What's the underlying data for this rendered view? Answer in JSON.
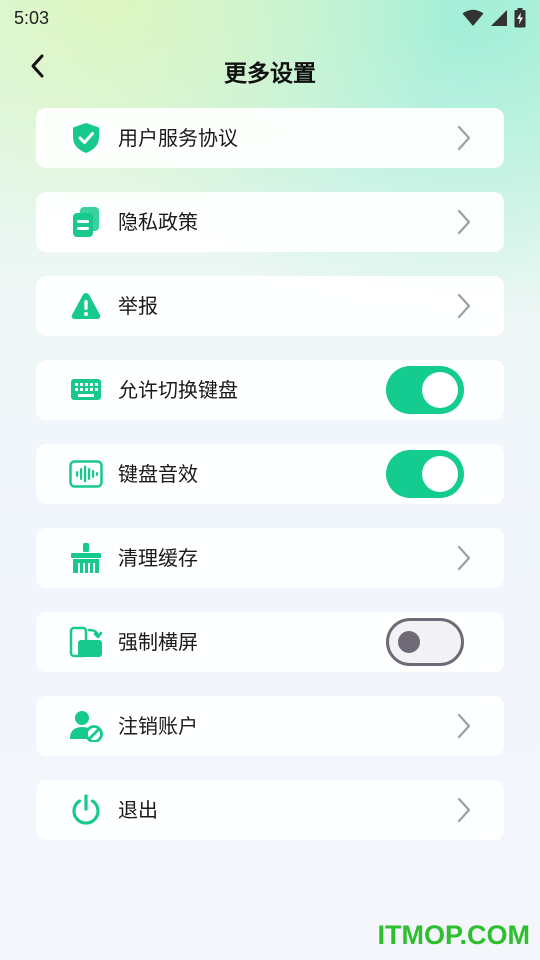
{
  "status_bar": {
    "time": "5:03",
    "icons": [
      "wifi-icon",
      "signal-icon",
      "battery-charging-icon"
    ]
  },
  "header": {
    "back_icon": "chevron-left-icon",
    "title": "更多设置"
  },
  "settings": {
    "items": [
      {
        "label": "用户服务协议",
        "icon": "shield-check-icon",
        "control": "chevron"
      },
      {
        "label": "隐私政策",
        "icon": "documents-icon",
        "control": "chevron"
      },
      {
        "label": "举报",
        "icon": "warning-icon",
        "control": "chevron"
      },
      {
        "label": "允许切换键盘",
        "icon": "keyboard-icon",
        "control": "toggle",
        "toggle_on": true
      },
      {
        "label": "键盘音效",
        "icon": "sound-wave-icon",
        "control": "toggle",
        "toggle_on": true
      },
      {
        "label": "清理缓存",
        "icon": "brush-icon",
        "control": "chevron"
      },
      {
        "label": "强制横屏",
        "icon": "rotate-screen-icon",
        "control": "toggle",
        "toggle_on": false
      },
      {
        "label": "注销账户",
        "icon": "user-block-icon",
        "control": "chevron"
      },
      {
        "label": "退出",
        "icon": "power-icon",
        "control": "chevron"
      }
    ]
  },
  "watermark": "ITMOP.COM",
  "colors": {
    "accent": "#14cc8f",
    "icon": "#17c98d",
    "toggle_off": "#6f6a75"
  }
}
